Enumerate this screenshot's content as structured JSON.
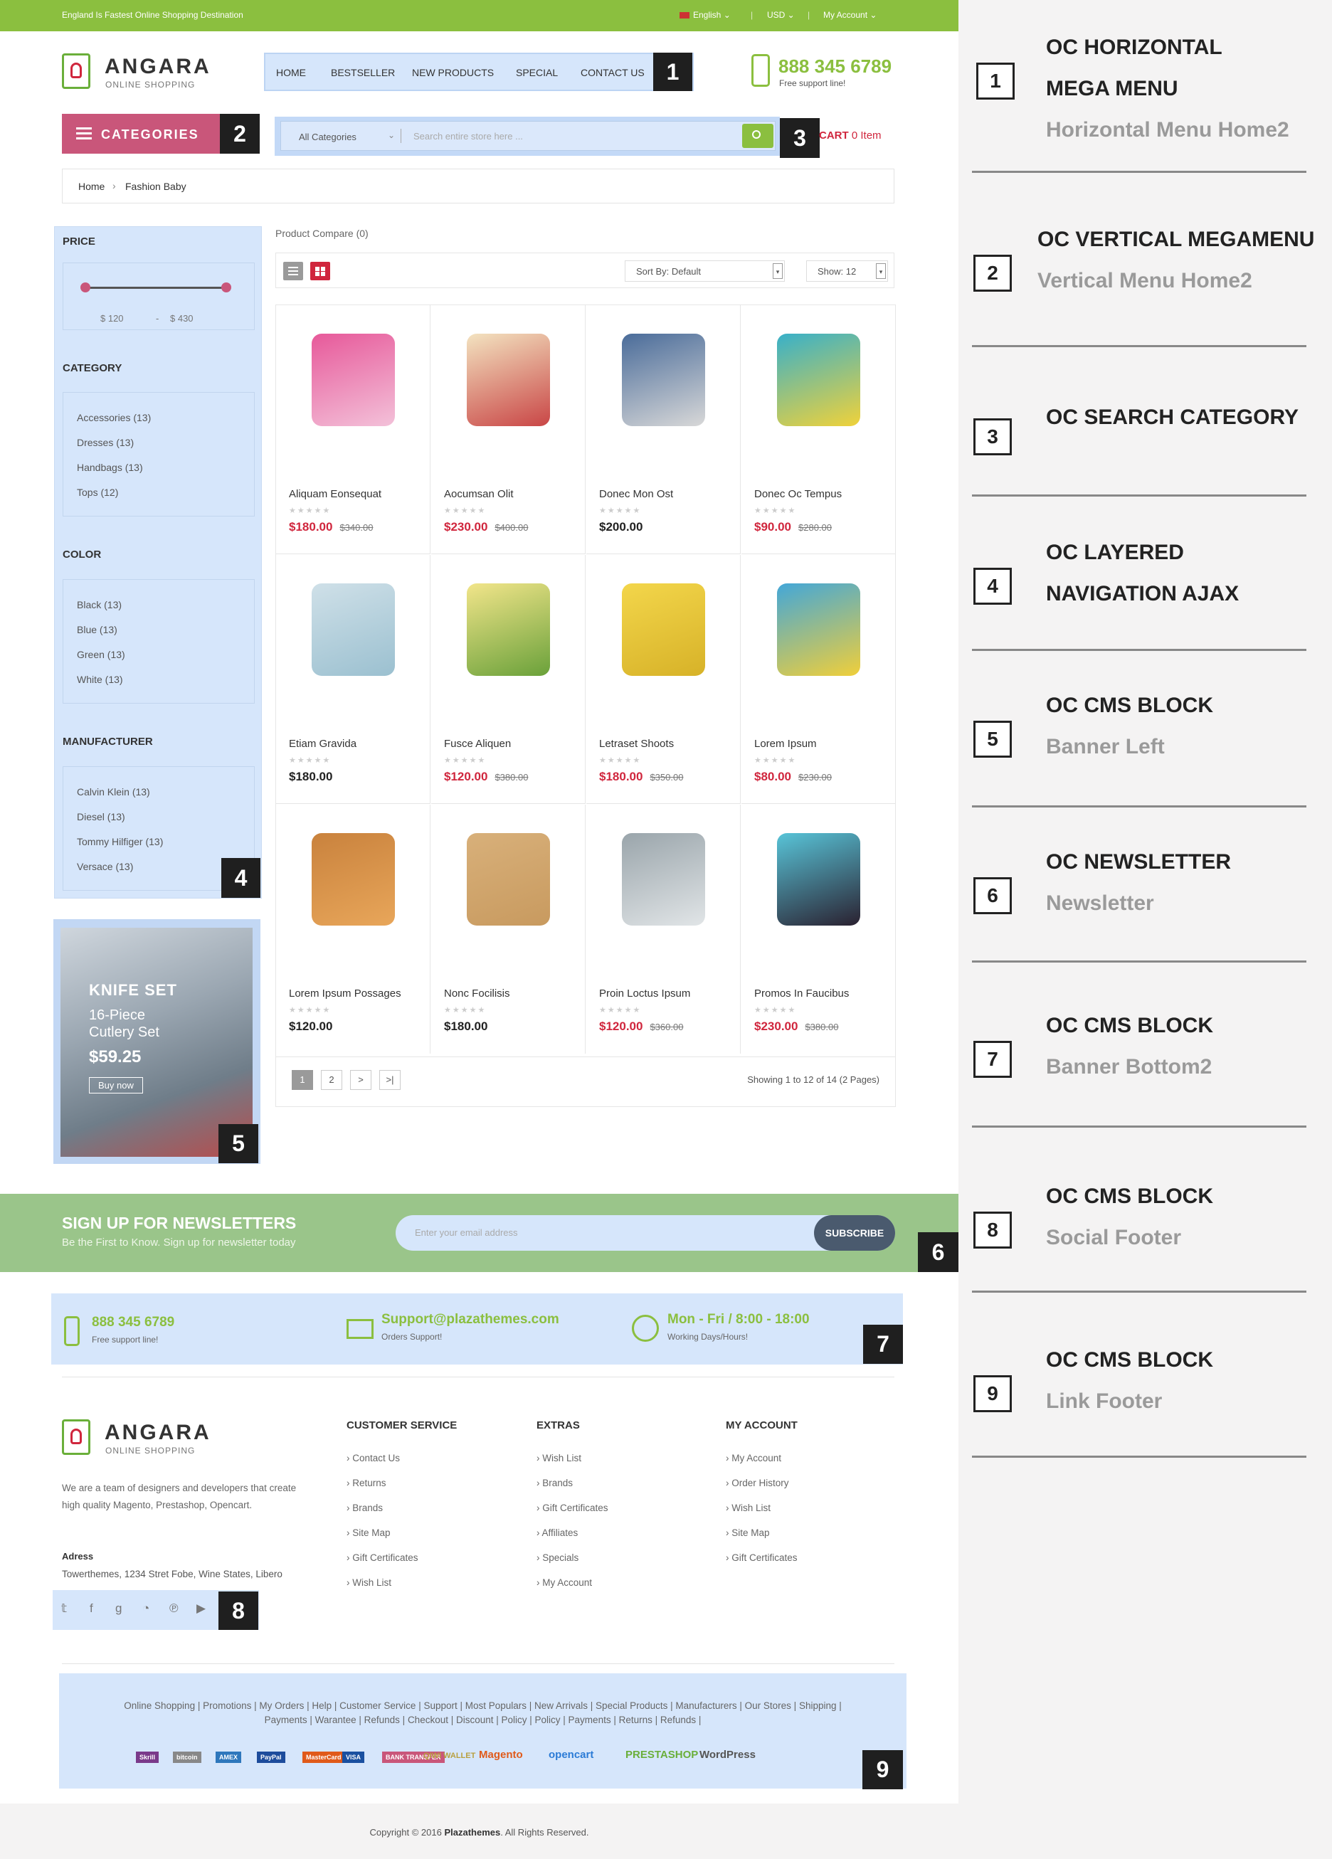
{
  "topbar": {
    "tagline": "England Is Fastest Online Shopping Destination",
    "language": "English",
    "currency": "USD",
    "account": "My Account"
  },
  "logo": {
    "name": "ANGARA",
    "sub": "ONLINE SHOPPING"
  },
  "hmenu": {
    "items": [
      "HOME",
      "BESTSELLER",
      "NEW PRODUCTS",
      "SPECIAL",
      "CONTACT US"
    ]
  },
  "header": {
    "phone": "888 345 6789",
    "support": "Free support line!",
    "cart_label": "CART",
    "cart_count": "0 Item"
  },
  "categories_label": "CATEGORIES",
  "search": {
    "category": "All Categories",
    "placeholder": "Search entire store here ..."
  },
  "breadcrumb": {
    "home": "Home",
    "current": "Fashion Baby"
  },
  "filters": {
    "price_title": "PRICE",
    "price_min": "$ 120",
    "price_max": "$ 430",
    "category_title": "CATEGORY",
    "categories": [
      "Accessories (13)",
      "Dresses (13)",
      "Handbags (13)",
      "Tops (12)"
    ],
    "color_title": "COLOR",
    "colors": [
      "Black (13)",
      "Blue (13)",
      "Green (13)",
      "White (13)"
    ],
    "manufacturer_title": "MANUFACTURER",
    "manufacturers": [
      "Calvin Klein (13)",
      "Diesel (13)",
      "Tommy Hilfiger (13)",
      "Versace (13)"
    ]
  },
  "banner_left": {
    "title": "KNIFE SET",
    "line1": "16-Piece",
    "line2": "Cutlery Set",
    "price": "$59.25",
    "button": "Buy now"
  },
  "toolbar": {
    "compare": "Product Compare (0)",
    "sort": "Sort By: Default",
    "show": "Show: 12"
  },
  "products": [
    {
      "name": "Aliquam Eonsequat",
      "price": "$180.00",
      "old": "$340.00",
      "sale": true
    },
    {
      "name": "Aocumsan Olit",
      "price": "$230.00",
      "old": "$400.00",
      "sale": true
    },
    {
      "name": "Donec Mon Ost",
      "price": "$200.00",
      "old": "",
      "sale": false
    },
    {
      "name": "Donec Oc Tempus",
      "price": "$90.00",
      "old": "$280.00",
      "sale": true
    },
    {
      "name": "Etiam Gravida",
      "price": "$180.00",
      "old": "",
      "sale": false
    },
    {
      "name": "Fusce Aliquen",
      "price": "$120.00",
      "old": "$380.00",
      "sale": true
    },
    {
      "name": "Letraset Shoots",
      "price": "$180.00",
      "old": "$350.00",
      "sale": true
    },
    {
      "name": "Lorem Ipsum",
      "price": "$80.00",
      "old": "$230.00",
      "sale": true
    },
    {
      "name": "Lorem Ipsum Possages",
      "price": "$120.00",
      "old": "",
      "sale": false
    },
    {
      "name": "Nonc Focilisis",
      "price": "$180.00",
      "old": "",
      "sale": false
    },
    {
      "name": "Proin Loctus Ipsum",
      "price": "$120.00",
      "old": "$360.00",
      "sale": true
    },
    {
      "name": "Promos In Faucibus",
      "price": "$230.00",
      "old": "$380.00",
      "sale": true
    }
  ],
  "pagination": {
    "pages": [
      "1",
      "2",
      ">",
      ">|"
    ],
    "summary": "Showing 1 to 12 of 14 (2 Pages)"
  },
  "newsletter": {
    "title": "SIGN UP FOR NEWSLETTERS",
    "sub": "Be the First to Know. Sign up for newsletter today",
    "placeholder": "Enter your email address",
    "button": "SUBSCRIBE"
  },
  "contact_block": {
    "phone": "888 345 6789",
    "phone_sub": "Free support line!",
    "email": "Support@plazathemes.com",
    "email_sub": "Orders Support!",
    "hours": "Mon - Fri / 8:00 - 18:00",
    "hours_sub": "Working Days/Hours!"
  },
  "footer": {
    "about": "We are a team of designers and developers that create high quality Magento, Prestashop, Opencart.",
    "address_title": "Adress",
    "address": "Towerthemes, 1234 Stret Fobe, Wine States, Libero",
    "cols": [
      {
        "title": "CUSTOMER SERVICE",
        "links": [
          "Contact Us",
          "Returns",
          "Brands",
          "Site Map",
          "Gift Certificates",
          "Wish List"
        ]
      },
      {
        "title": "EXTRAS",
        "links": [
          "Wish List",
          "Brands",
          "Gift Certificates",
          "Affiliates",
          "Specials",
          "My Account"
        ]
      },
      {
        "title": "MY ACCOUNT",
        "links": [
          "My Account",
          "Order History",
          "Wish List",
          "Site Map",
          "Gift Certificates"
        ]
      }
    ],
    "social_icons": [
      "twitter-icon",
      "facebook-icon",
      "google-plus-icon",
      "rss-icon",
      "pinterest-icon",
      "youtube-icon"
    ],
    "link_row1": "Online Shopping | Promotions | My Orders | Help | Customer Service | Support | Most Populars | New Arrivals | Special Products | Manufacturers | Our Stores | Shipping |",
    "link_row2": "Payments | Warantee | Refunds | Checkout | Discount | Policy | Policy | Payments | Returns | Refunds |",
    "payments": [
      "Skrill",
      "bitcoin",
      "AMEX",
      "PayPal",
      "MasterCard",
      "VISA",
      "BANK TRANSFER",
      "QIWI WALLET",
      "Magento",
      "opencart",
      "PRESTASHOP",
      "WordPress"
    ],
    "copyright_pre": "Copyright © 2016 ",
    "copyright_brand": "Plazathemes",
    "copyright_post": ". All Rights Reserved."
  },
  "badges": [
    "1",
    "2",
    "3",
    "4",
    "5",
    "6",
    "7",
    "8",
    "9"
  ],
  "legend": [
    {
      "num": "1",
      "title1": "OC HORIZONTAL",
      "title2": "MEGA MENU",
      "sub": "Horizontal Menu Home2"
    },
    {
      "num": "2",
      "title1": "OC VERTICAL MEGAMENU",
      "title2": "",
      "sub": "Vertical Menu Home2"
    },
    {
      "num": "3",
      "title1": "OC SEARCH CATEGORY",
      "title2": "",
      "sub": ""
    },
    {
      "num": "4",
      "title1": "OC LAYERED",
      "title2": "NAVIGATION AJAX",
      "sub": ""
    },
    {
      "num": "5",
      "title1": "OC CMS BLOCK",
      "title2": "",
      "sub": "Banner Left"
    },
    {
      "num": "6",
      "title1": "OC NEWSLETTER",
      "title2": "",
      "sub": "Newsletter"
    },
    {
      "num": "7",
      "title1": "OC CMS BLOCK",
      "title2": "",
      "sub": "Banner Bottom2"
    },
    {
      "num": "8",
      "title1": "OC CMS BLOCK",
      "title2": "",
      "sub": "Social Footer"
    },
    {
      "num": "9",
      "title1": "OC CMS BLOCK",
      "title2": "",
      "sub": "Link Footer"
    }
  ],
  "colors": {
    "green": "#8bbf3f",
    "pink": "#c9567a",
    "highlight": "#d6e6fb",
    "sale_price": "#d0263d"
  }
}
